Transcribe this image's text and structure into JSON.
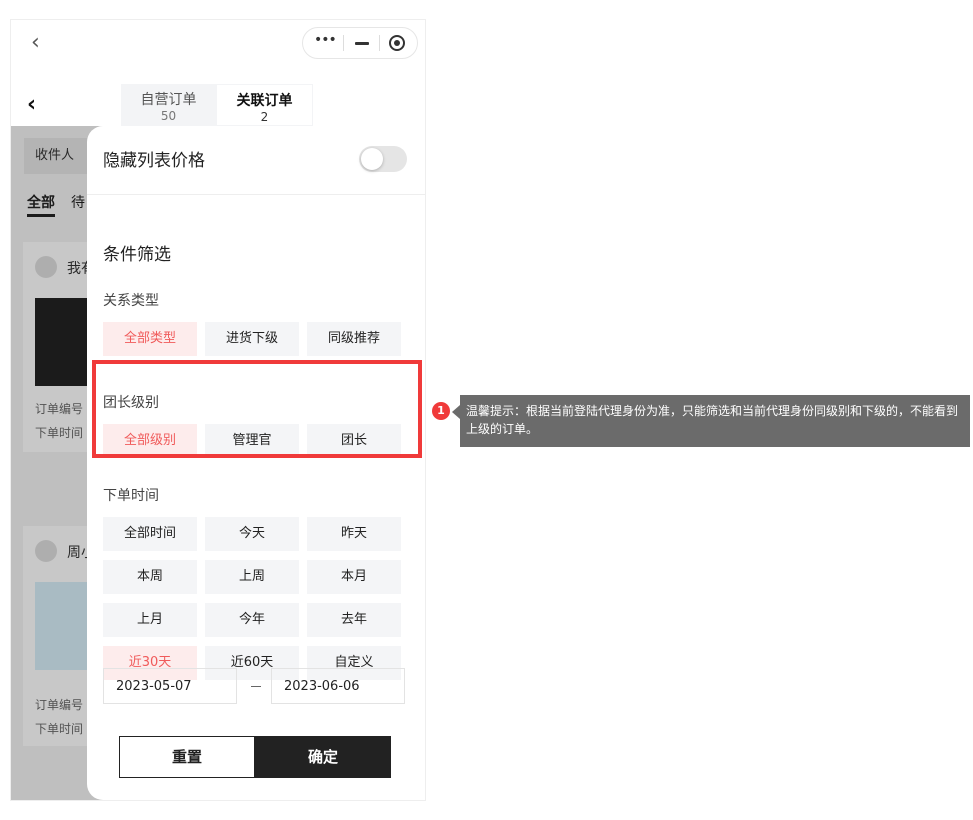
{
  "tabs": {
    "self_label": "自营订单",
    "self_count": "50",
    "linked_label": "关联订单",
    "linked_count": "2"
  },
  "behind": {
    "recipient_label": "收件人",
    "tab_all": "全部",
    "tab_partial": "待",
    "card1_name": "我有",
    "card2_name": "周小",
    "order_no": "订单编号",
    "order_time": "下单时间"
  },
  "drawer": {
    "hide_price_label": "隐藏列表价格",
    "hide_price_on": false,
    "filter_title": "条件筛选",
    "relation": {
      "title": "关系类型",
      "options": [
        "全部类型",
        "进货下级",
        "同级推荐"
      ],
      "selected": "全部类型"
    },
    "level": {
      "title": "团长级别",
      "options": [
        "全部级别",
        "管理官",
        "团长"
      ],
      "selected": "全部级别"
    },
    "time": {
      "title": "下单时间",
      "options": [
        "全部时间",
        "今天",
        "昨天",
        "本周",
        "上周",
        "本月",
        "上月",
        "今年",
        "去年",
        "近30天",
        "近60天",
        "自定义"
      ],
      "selected": "近30天"
    },
    "start_date": "2023-05-07",
    "end_date": "2023-06-06",
    "reset_label": "重置",
    "confirm_label": "确定"
  },
  "annotation": {
    "badge_number": "1",
    "tip": "温馨提示：根据当前登陆代理身份为准，只能筛选和当前代理身份同级别和下级的，不能看到上级的订单。",
    "highlight_color": "#f03a3a"
  },
  "colors": {
    "accent_text": "#f05a5a",
    "accent_bg": "#fdecec",
    "primary_button": "#222222"
  }
}
